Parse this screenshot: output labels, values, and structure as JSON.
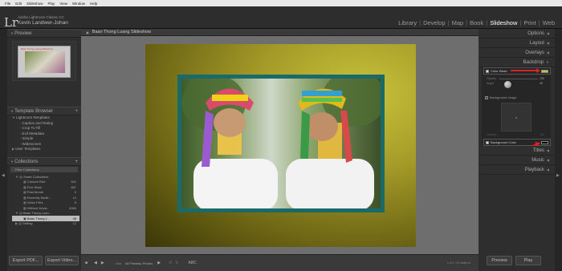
{
  "menu": [
    "File",
    "Edit",
    "Slideshow",
    "Play",
    "View",
    "Window",
    "Help"
  ],
  "identity": {
    "line1": "Adobe Lightroom Classic CC",
    "line2": "Kevin Landwer-Johan"
  },
  "modules": [
    "Library",
    "Develop",
    "Map",
    "Book",
    "Slideshow",
    "Print",
    "Web"
  ],
  "left": {
    "preview_title": "Preview",
    "preview_slide_title": "Baan Thong Luang Slideshow",
    "template_browser_title": "Template Browser",
    "templates": [
      "Lightroom Templates",
      "Caption and Rating",
      "Crop To Fill",
      "Exif Metadata",
      "Simple",
      "Widescreen",
      "User Templates"
    ],
    "collections_title": "Collections",
    "filter": "Filter Collections",
    "collections": [
      {
        "name": "Smart Collections",
        "count": ""
      },
      {
        "name": "Colored Red",
        "count": "611"
      },
      {
        "name": "Five Stars",
        "count": "487"
      },
      {
        "name": "Past Month",
        "count": "0"
      },
      {
        "name": "Recently Modif...",
        "count": "12"
      },
      {
        "name": "Video Files",
        "count": "8"
      },
      {
        "name": "Without Keyw...",
        "count": "4084"
      },
      {
        "name": "Baan Thong Luan...",
        "count": ""
      },
      {
        "name": "Baan Thong L...",
        "count": "48"
      },
      {
        "name": "Setting",
        "count": "12"
      }
    ],
    "export_pdf": "Export PDF...",
    "export_video": "Export Video..."
  },
  "center": {
    "title": "Baan Thong Luang Slideshow",
    "toolbar_use": "Use:",
    "toolbar_use_value": "All Filmstrip Photos",
    "toolbar_abc": "ABC",
    "toolbar_count": "1 of 1 / 41 slides in"
  },
  "right": {
    "sections": [
      "Options",
      "Layout",
      "Overlays",
      "Backdrop"
    ],
    "color_wash": "Color Wash",
    "opacity_label": "Opacity",
    "opacity_value": "100",
    "angle_label": "Angle",
    "angle_value": "45",
    "background_image": "Background Image",
    "bg_opacity_label": "Opacity",
    "bg_opacity_value": "100",
    "background_color": "Background Color",
    "sections_bottom": [
      "Titles",
      "Music",
      "Playback"
    ],
    "preview_btn": "Preview",
    "play_btn": "Play"
  },
  "colors": {
    "wash": "#c8c43a",
    "background": "#000000",
    "frame": "#1a6a6a",
    "arrow": "#e02020"
  }
}
